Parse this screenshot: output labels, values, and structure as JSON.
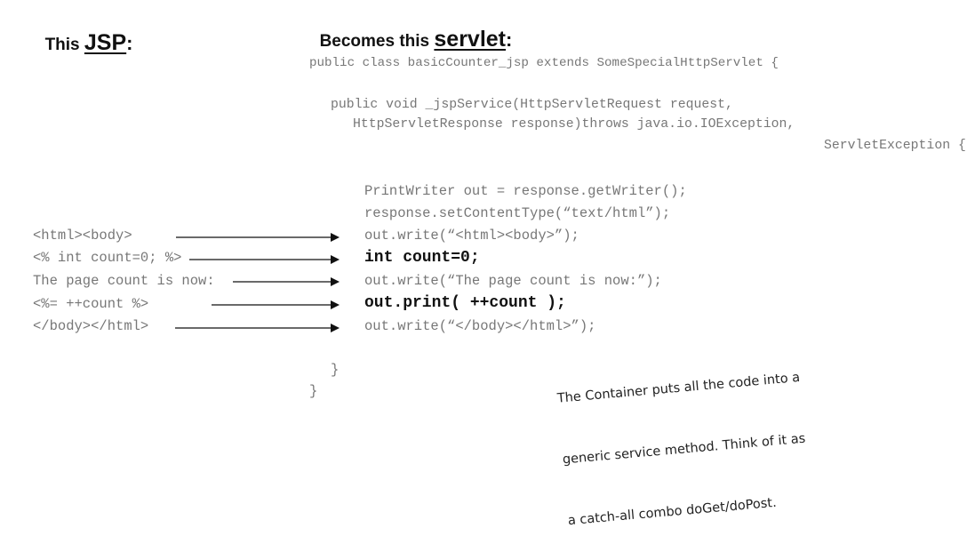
{
  "jsp_heading": {
    "prefix": "This ",
    "emphasis": "JSP",
    "suffix": ":"
  },
  "servlet_heading": {
    "prefix": "Becomes this ",
    "emphasis": "servlet",
    "suffix": ":"
  },
  "servlet_code": {
    "class_decl": "public class basicCounter_jsp extends SomeSpecialHttpServlet {",
    "method_line1": "public void _jspService(HttpServletRequest request,",
    "method_line2": "HttpServletResponse response)throws java.io.IOException,",
    "method_line3": "ServletException {",
    "writer_line": "PrintWriter out = response.getWriter();",
    "content_type_line": "response.setContentType(“text/html”);",
    "write_open": "out.write(“<html><body>”);",
    "count_decl": "int count=0;",
    "write_text": "out.write(“The page count is now:”);",
    "print_count": "out.print( ++count );",
    "write_close": "out.write(“</body></html>”);",
    "method_close": "}",
    "class_close": "}"
  },
  "jsp_code": {
    "html_open": "<html><body>",
    "scriptlet": "<% int count=0; %>",
    "template_text": "The page count is now:",
    "expression": "<%= ++count %>",
    "html_close": "</body></html>"
  },
  "handwritten_note": {
    "line1": "The Container puts all the code into a",
    "line2": "generic service method. Think of it as",
    "line3": "a catch-all combo doGet/doPost."
  },
  "colors": {
    "code": "#777777",
    "emphasis": "#111111",
    "arrow": "#111111"
  }
}
